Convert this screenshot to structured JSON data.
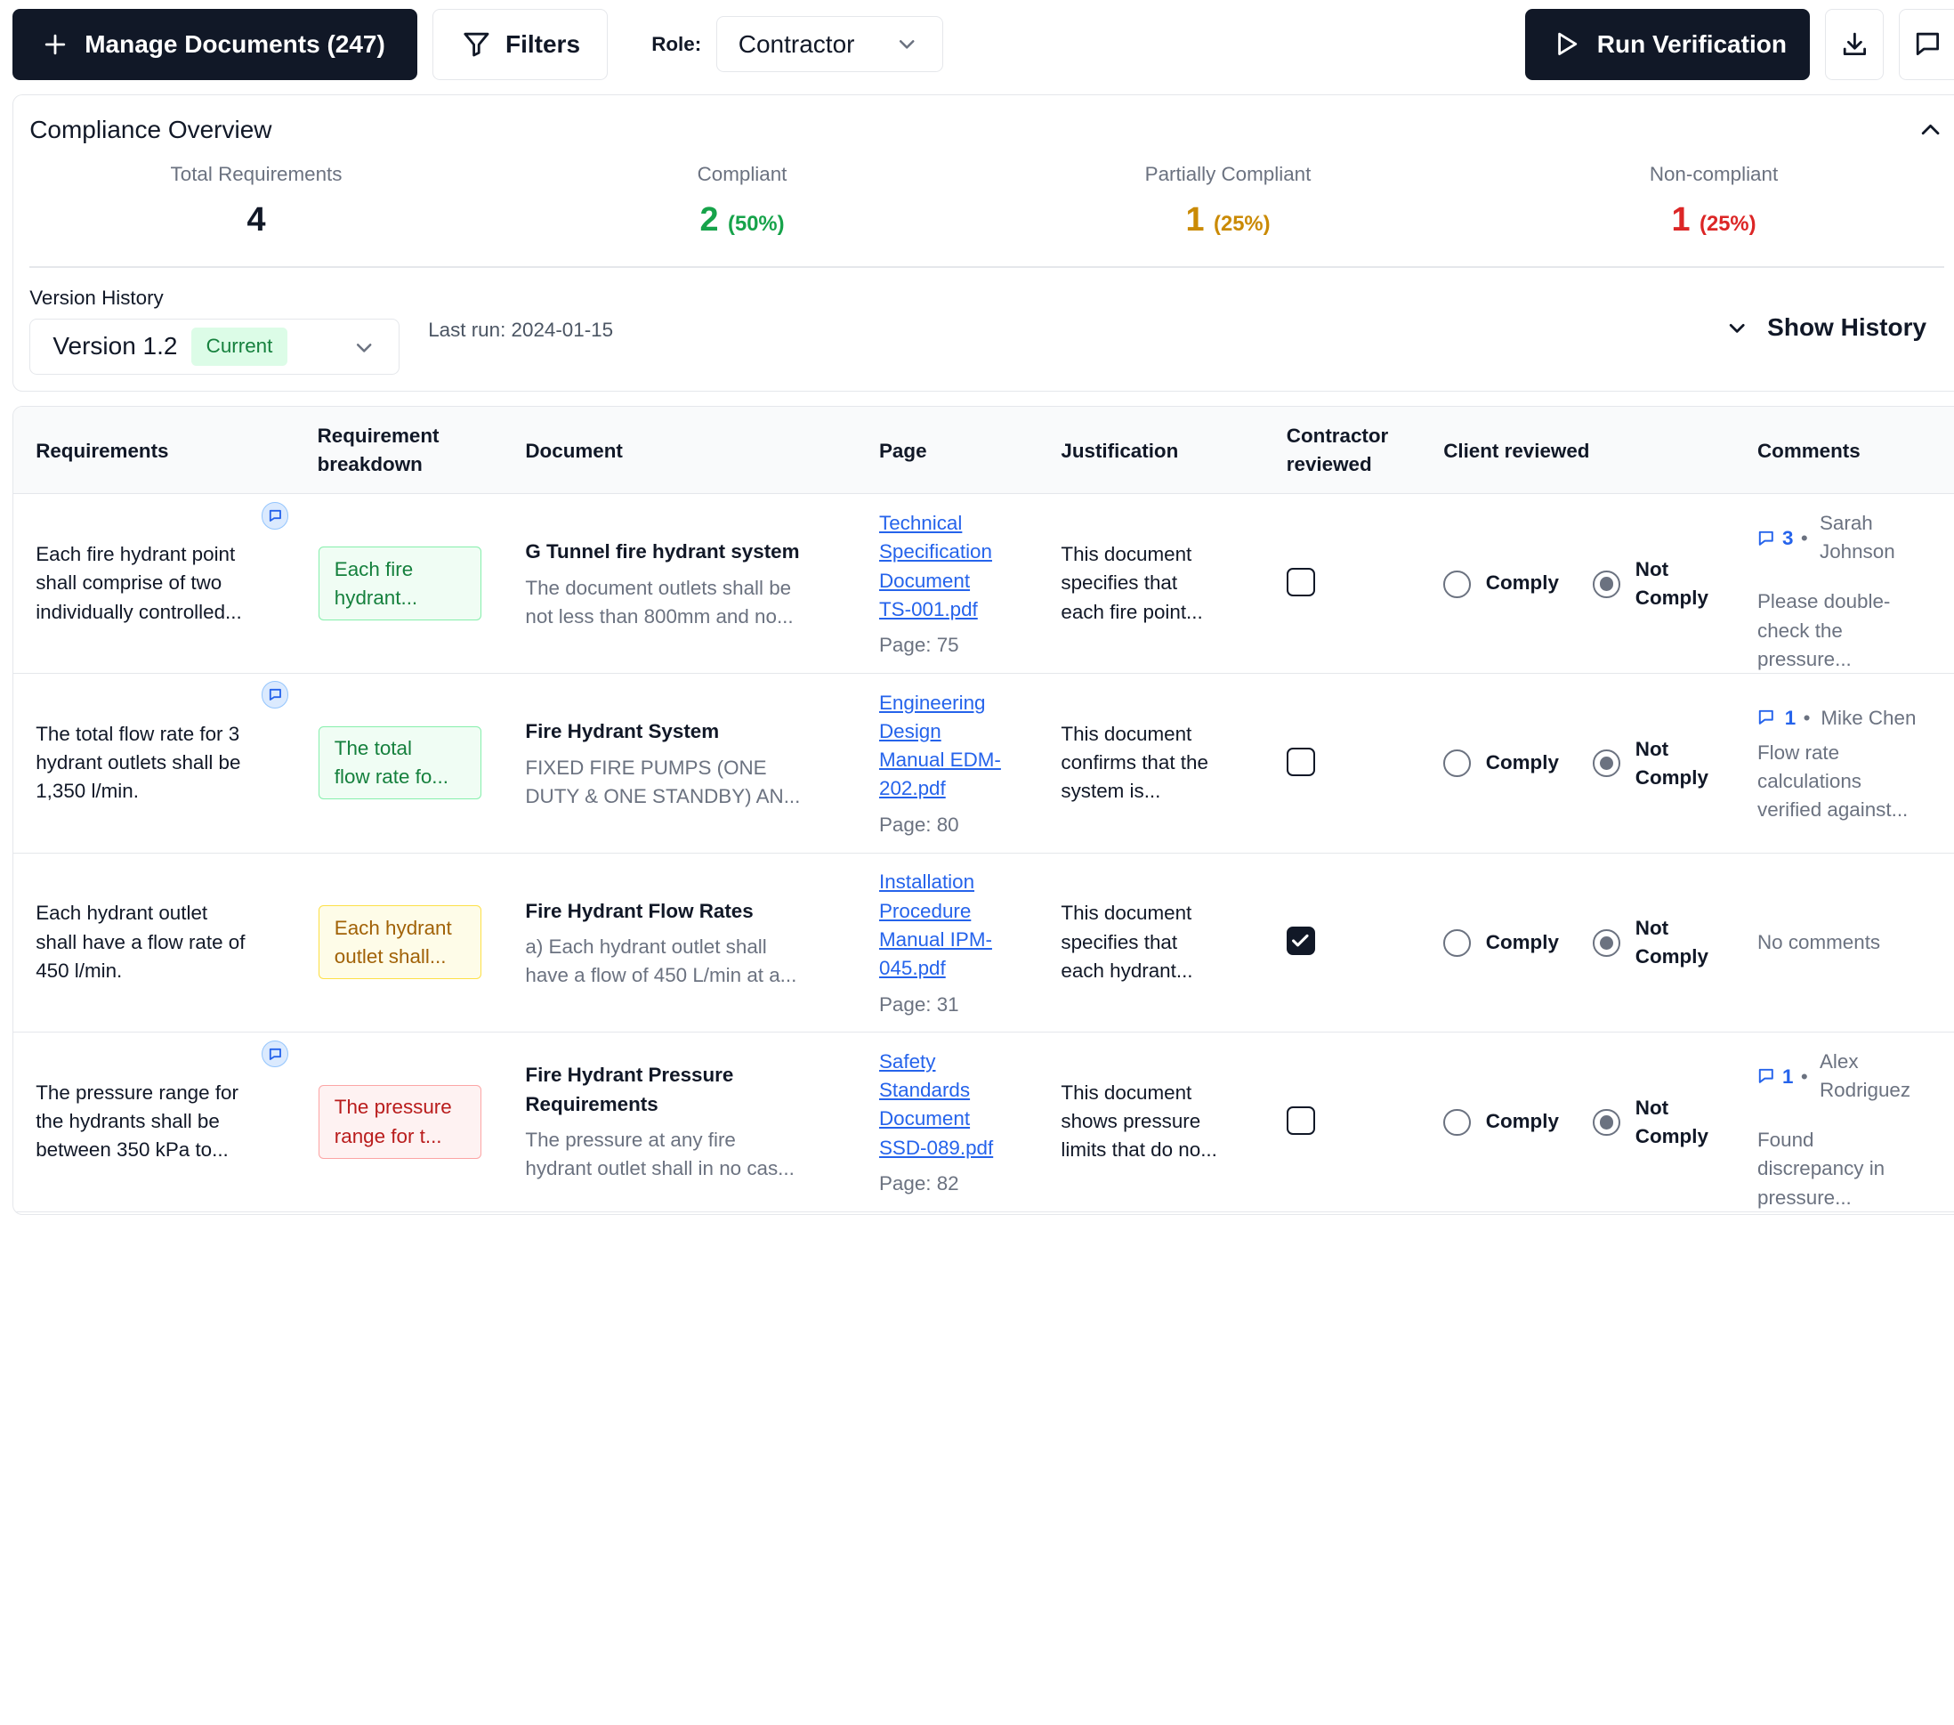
{
  "toolbar": {
    "manage_label": "Manage Documents (247)",
    "filters_label": "Filters",
    "role_label": "Role:",
    "role_value": "Contractor",
    "run_label": "Run Verification"
  },
  "overview": {
    "title": "Compliance Overview",
    "stats": [
      {
        "label": "Total Requirements",
        "value": "4",
        "pct": "",
        "color": "#111827"
      },
      {
        "label": "Compliant",
        "value": "2",
        "pct": "(50%)",
        "color": "#16a34a"
      },
      {
        "label": "Partially Compliant",
        "value": "1",
        "pct": "(25%)",
        "color": "#ca8a04"
      },
      {
        "label": "Non-compliant",
        "value": "1",
        "pct": "(25%)",
        "color": "#dc2626"
      }
    ],
    "version_history_label": "Version History",
    "version_value": "Version 1.2",
    "version_badge": "Current",
    "last_run": "Last run: 2024-01-15",
    "show_history_label": "Show History"
  },
  "table": {
    "headers": {
      "requirements": "Requirements",
      "breakdown_1": "Requirement",
      "breakdown_2": "breakdown",
      "document": "Document",
      "page": "Page",
      "justification": "Justification",
      "contractor_1": "Contractor",
      "contractor_2": "reviewed",
      "client": "Client reviewed",
      "comments": "Comments"
    },
    "comply_label": "Comply",
    "not_label": "Not",
    "comply2_label": "Comply",
    "rows": [
      {
        "req": [
          "Each fire hydrant point",
          "shall comprise of two",
          "individually controlled..."
        ],
        "tag": [
          "Each fire",
          "hydrant..."
        ],
        "tag_color": "green",
        "doc_title": [
          "G Tunnel fire hydrant system"
        ],
        "doc_desc": [
          "The document outlets shall be",
          "not less than 800mm and no..."
        ],
        "page_link": [
          "Technical",
          "Specification",
          "Document",
          "TS-001.pdf"
        ],
        "page_num": "Page: 75",
        "just": [
          "This document",
          "specifies that",
          "each fire point..."
        ],
        "contractor_checked": false,
        "has_bubble": true,
        "comment_count": "3",
        "comment_author": [
          "Sarah",
          "Johnson"
        ],
        "comment_text": [
          "Please double-",
          "check the",
          "pressure..."
        ]
      },
      {
        "req": [
          "The total flow rate for 3",
          "hydrant outlets shall be",
          "1,350 l/min."
        ],
        "tag": [
          "The total",
          "flow rate fo..."
        ],
        "tag_color": "green",
        "doc_title": [
          "Fire Hydrant System"
        ],
        "doc_desc": [
          "FIXED FIRE PUMPS (ONE",
          "DUTY & ONE STANDBY) AN..."
        ],
        "page_link": [
          "Engineering",
          "Design",
          "Manual EDM-",
          "202.pdf"
        ],
        "page_num": "Page: 80",
        "just": [
          "This document",
          "confirms that the",
          "system is..."
        ],
        "contractor_checked": false,
        "has_bubble": true,
        "comment_count": "1",
        "comment_author": [
          "Mike Chen"
        ],
        "comment_text": [
          "Flow rate",
          "calculations",
          "verified against..."
        ]
      },
      {
        "req": [
          "Each hydrant outlet",
          "shall have a flow rate of",
          "450 l/min."
        ],
        "tag": [
          "Each hydrant",
          "outlet shall..."
        ],
        "tag_color": "yellow",
        "doc_title": [
          "Fire Hydrant Flow Rates"
        ],
        "doc_desc": [
          "a) Each hydrant outlet shall",
          "have a flow of 450 L/min at a..."
        ],
        "page_link": [
          "Installation",
          "Procedure",
          "Manual IPM-",
          "045.pdf"
        ],
        "page_num": "Page: 31",
        "just": [
          "This document",
          "specifies that",
          "each hydrant..."
        ],
        "contractor_checked": true,
        "has_bubble": false,
        "no_comments": "No comments"
      },
      {
        "req": [
          "The pressure range for",
          "the hydrants shall be",
          "between 350 kPa to..."
        ],
        "tag": [
          "The pressure",
          "range for t..."
        ],
        "tag_color": "red",
        "doc_title": [
          "Fire Hydrant Pressure",
          "Requirements"
        ],
        "doc_desc": [
          "The pressure at any fire",
          "hydrant outlet shall in no cas..."
        ],
        "page_link": [
          "Safety",
          "Standards",
          "Document",
          "SSD-089.pdf"
        ],
        "page_num": "Page: 82",
        "just": [
          "This document",
          "shows pressure",
          "limits that do no..."
        ],
        "contractor_checked": false,
        "has_bubble": true,
        "comment_count": "1",
        "comment_author": [
          "Alex",
          "Rodriguez"
        ],
        "comment_text": [
          "Found",
          "discrepancy in",
          "pressure..."
        ]
      }
    ]
  }
}
